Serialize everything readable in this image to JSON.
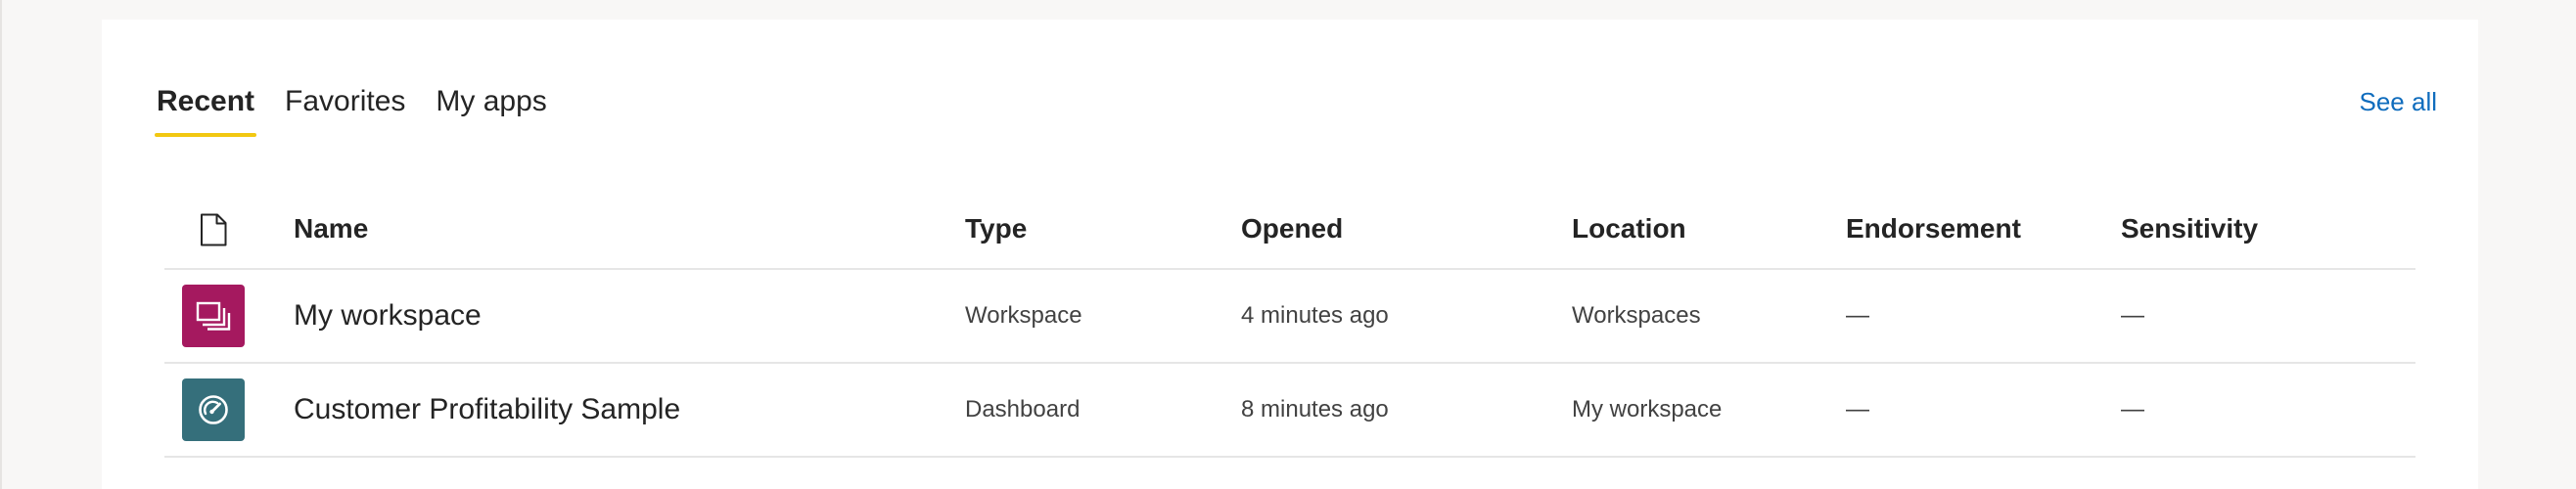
{
  "tabs": [
    {
      "label": "Recent",
      "active": true
    },
    {
      "label": "Favorites",
      "active": false
    },
    {
      "label": "My apps",
      "active": false
    }
  ],
  "see_all_label": "See all",
  "colors": {
    "tab_underline": "#f2c811",
    "link": "#0f6cbd",
    "workspace_tile": "#a5195f",
    "dashboard_tile": "#356f7b"
  },
  "table": {
    "header_icon": "document-icon",
    "columns": [
      "Name",
      "Type",
      "Opened",
      "Location",
      "Endorsement",
      "Sensitivity"
    ],
    "rows": [
      {
        "icon": "workspace-icon",
        "name": "My workspace",
        "type": "Workspace",
        "opened": "4 minutes ago",
        "location": "Workspaces",
        "endorsement": "—",
        "sensitivity": "—"
      },
      {
        "icon": "dashboard-icon",
        "name": "Customer Profitability Sample",
        "type": "Dashboard",
        "opened": "8 minutes ago",
        "location": "My workspace",
        "endorsement": "—",
        "sensitivity": "—"
      }
    ]
  }
}
